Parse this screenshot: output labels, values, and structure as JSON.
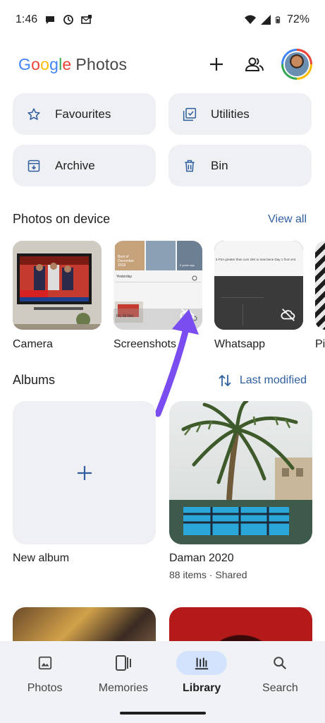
{
  "status": {
    "time": "1:46",
    "battery": "72%"
  },
  "header": {
    "logo_letters": [
      "G",
      "o",
      "o",
      "g",
      "l",
      "e"
    ],
    "logo_word": "Photos"
  },
  "quick_tiles": [
    {
      "label": "Favourites",
      "icon": "star-icon"
    },
    {
      "label": "Utilities",
      "icon": "checklist-icon"
    },
    {
      "label": "Archive",
      "icon": "archive-icon"
    },
    {
      "label": "Bin",
      "icon": "trash-icon"
    }
  ],
  "device_section": {
    "title": "Photos on device",
    "link": "View all",
    "folders": [
      {
        "label": "Camera"
      },
      {
        "label": "Screenshots"
      },
      {
        "label": "Whatsapp"
      },
      {
        "label": "Pi"
      }
    ],
    "screenshot_thumb_text": {
      "line1": "Best of",
      "line2": "December",
      "line3": "2018",
      "line4": "5 years ago",
      "yesterday": "Yesterday",
      "date": "Fri, 16 Dec"
    },
    "whatsapp_thumb_text": "5 P2A greater than cum 25K to new bene Day 1 from ent"
  },
  "albums_section": {
    "title": "Albums",
    "sort_label": "Last modified",
    "albums": [
      {
        "name": "New album",
        "meta": ""
      },
      {
        "name": "Daman 2020",
        "meta": "88 items · Shared"
      }
    ]
  },
  "nav": {
    "items": [
      {
        "label": "Photos",
        "icon": "photo-icon",
        "active": false
      },
      {
        "label": "Memories",
        "icon": "memories-icon",
        "active": false
      },
      {
        "label": "Library",
        "icon": "library-icon",
        "active": true
      },
      {
        "label": "Search",
        "icon": "search-icon",
        "active": false
      }
    ]
  },
  "colors": {
    "accent": "#2f5f9e",
    "tile_bg": "#eef0f3",
    "nav_bg": "#f0f2f6",
    "active_pill": "#d3e3fd",
    "annotation_arrow": "#7a4df0"
  }
}
